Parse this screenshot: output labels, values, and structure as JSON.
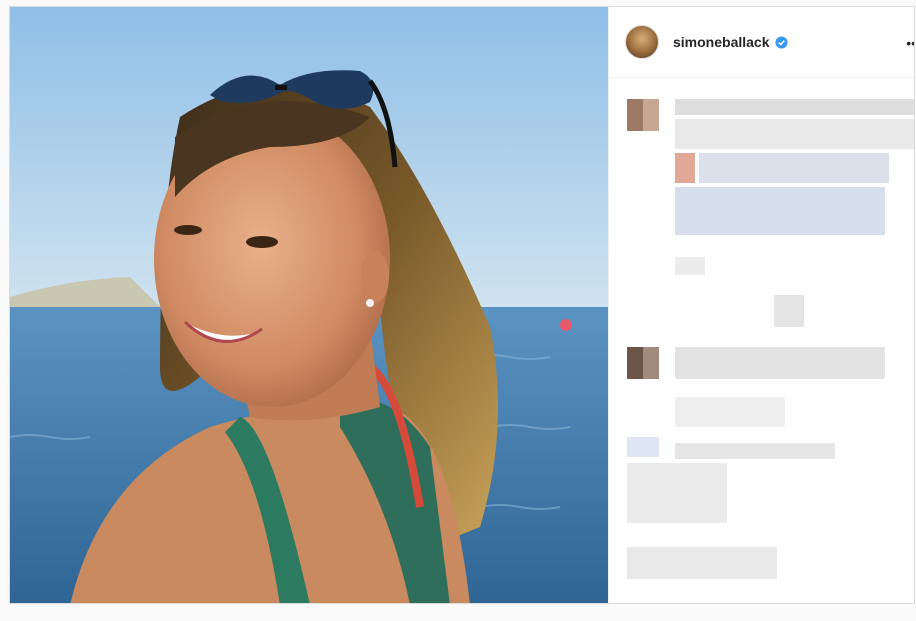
{
  "post": {
    "username": "simoneballack",
    "verified": true,
    "more_glyph": "• •"
  },
  "icons": {
    "verified": "verified-badge-icon",
    "more": "more-options-icon"
  },
  "colors": {
    "verified_blue": "#3897f0",
    "text": "#262626",
    "border": "#dbdbdb"
  }
}
